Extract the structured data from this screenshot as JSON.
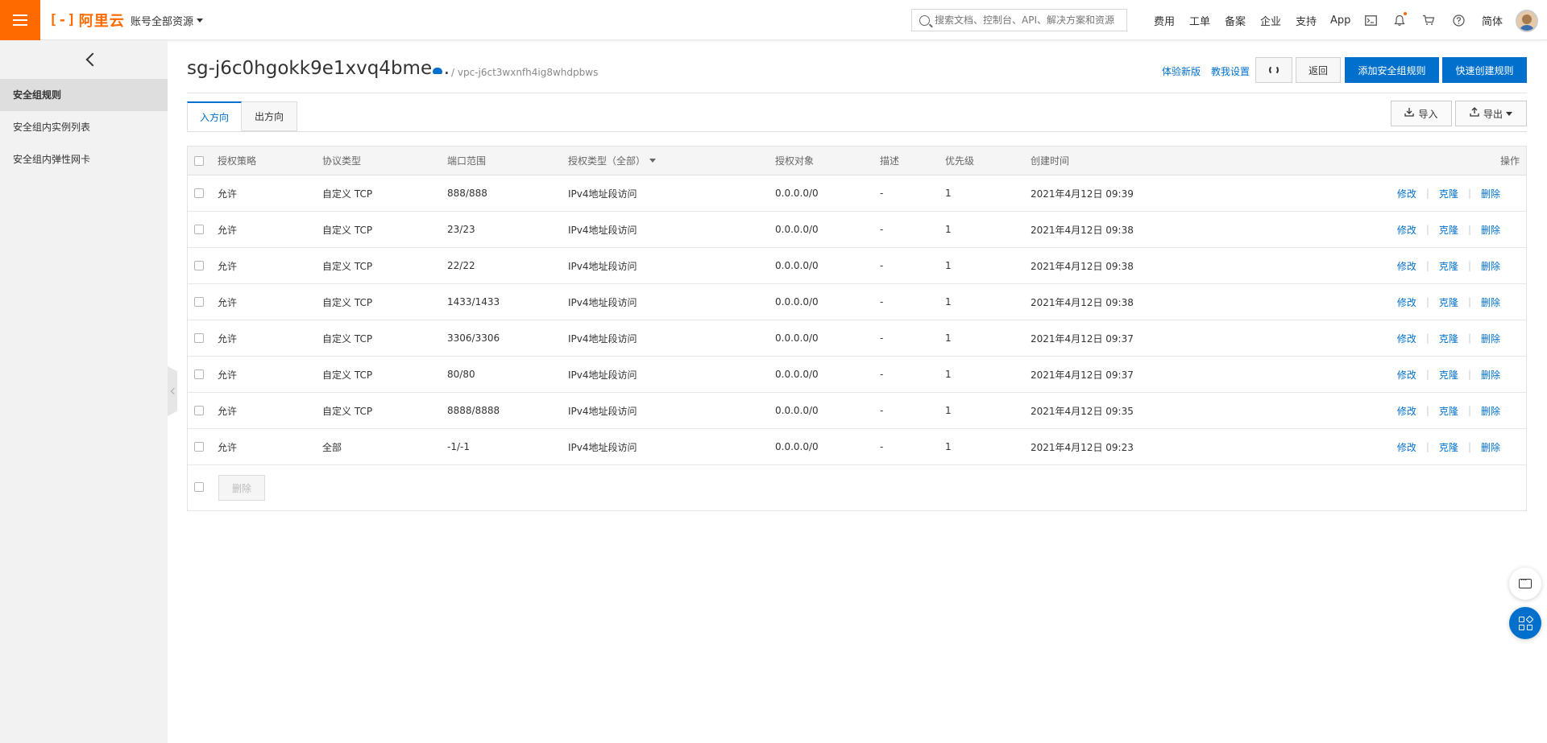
{
  "topbar": {
    "logo_text": "阿里云",
    "logo_mark": "[-]",
    "account_label": "账号全部资源",
    "search_placeholder": "搜索文档、控制台、API、解决方案和资源",
    "nav": [
      "费用",
      "工单",
      "备案",
      "企业",
      "支持",
      "App"
    ],
    "language": "简体",
    "accent_color": "#ff6a00"
  },
  "sidebar": {
    "items": [
      {
        "label": "安全组规则",
        "active": true
      },
      {
        "label": "安全组内实例列表",
        "active": false
      },
      {
        "label": "安全组内弹性网卡",
        "active": false
      }
    ]
  },
  "header": {
    "title": "sg-j6c0hgokk9e1xvq4bme...",
    "breadcrumb": "/ vpc-j6ct3wxnfh4ig8whdpbws",
    "link_new_version": "体验新版",
    "link_help_setup": "教我设置",
    "btn_back": "返回",
    "btn_add_rule": "添加安全组规则",
    "btn_quick_create": "快速创建规则"
  },
  "tabs": [
    {
      "label": "入方向",
      "active": true
    },
    {
      "label": "出方向",
      "active": false
    }
  ],
  "tools": {
    "import_label": "导入",
    "export_label": "导出"
  },
  "table": {
    "columns": {
      "policy": "授权策略",
      "protocol": "协议类型",
      "port": "端口范围",
      "auth_type": "授权类型（全部）",
      "target": "授权对象",
      "desc": "描述",
      "priority": "优先级",
      "created": "创建时间",
      "actions": "操作"
    },
    "rows": [
      {
        "policy": "允许",
        "protocol": "自定义 TCP",
        "port": "888/888",
        "auth_type": "IPv4地址段访问",
        "target": "0.0.0.0/0",
        "desc": "-",
        "priority": "1",
        "created": "2021年4月12日 09:39"
      },
      {
        "policy": "允许",
        "protocol": "自定义 TCP",
        "port": "23/23",
        "auth_type": "IPv4地址段访问",
        "target": "0.0.0.0/0",
        "desc": "-",
        "priority": "1",
        "created": "2021年4月12日 09:38"
      },
      {
        "policy": "允许",
        "protocol": "自定义 TCP",
        "port": "22/22",
        "auth_type": "IPv4地址段访问",
        "target": "0.0.0.0/0",
        "desc": "-",
        "priority": "1",
        "created": "2021年4月12日 09:38"
      },
      {
        "policy": "允许",
        "protocol": "自定义 TCP",
        "port": "1433/1433",
        "auth_type": "IPv4地址段访问",
        "target": "0.0.0.0/0",
        "desc": "-",
        "priority": "1",
        "created": "2021年4月12日 09:38"
      },
      {
        "policy": "允许",
        "protocol": "自定义 TCP",
        "port": "3306/3306",
        "auth_type": "IPv4地址段访问",
        "target": "0.0.0.0/0",
        "desc": "-",
        "priority": "1",
        "created": "2021年4月12日 09:37"
      },
      {
        "policy": "允许",
        "protocol": "自定义 TCP",
        "port": "80/80",
        "auth_type": "IPv4地址段访问",
        "target": "0.0.0.0/0",
        "desc": "-",
        "priority": "1",
        "created": "2021年4月12日 09:37"
      },
      {
        "policy": "允许",
        "protocol": "自定义 TCP",
        "port": "8888/8888",
        "auth_type": "IPv4地址段访问",
        "target": "0.0.0.0/0",
        "desc": "-",
        "priority": "1",
        "created": "2021年4月12日 09:35"
      },
      {
        "policy": "允许",
        "protocol": "全部",
        "port": "-1/-1",
        "auth_type": "IPv4地址段访问",
        "target": "0.0.0.0/0",
        "desc": "-",
        "priority": "1",
        "created": "2021年4月12日 09:23"
      }
    ],
    "actions": {
      "edit": "修改",
      "clone": "克隆",
      "delete": "删除"
    },
    "bulk_delete": "删除"
  }
}
